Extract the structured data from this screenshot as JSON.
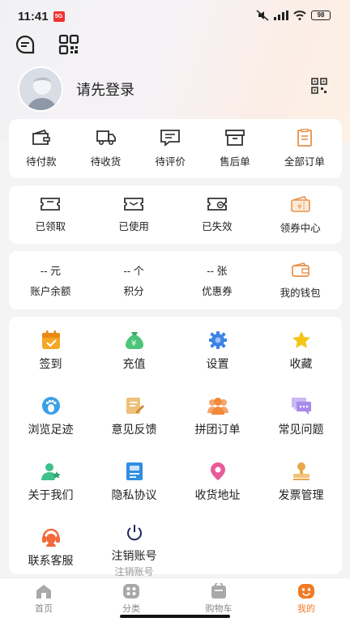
{
  "status": {
    "time": "11:41",
    "notification_badge": "5G",
    "battery": "98"
  },
  "user": {
    "login_prompt": "请先登录"
  },
  "orders": [
    {
      "label": "待付款",
      "icon": "wallet-icon"
    },
    {
      "label": "待收货",
      "icon": "truck-icon"
    },
    {
      "label": "待评价",
      "icon": "comment-icon"
    },
    {
      "label": "售后单",
      "icon": "box-icon"
    },
    {
      "label": "全部订单",
      "icon": "clipboard-icon"
    }
  ],
  "coupons": [
    {
      "label": "已领取",
      "icon": "ticket-received-icon"
    },
    {
      "label": "已使用",
      "icon": "ticket-used-icon"
    },
    {
      "label": "已失效",
      "icon": "ticket-expired-icon"
    },
    {
      "label": "领券中心",
      "icon": "coupon-center-icon"
    }
  ],
  "assets": [
    {
      "value": "-- 元",
      "label": "账户余额"
    },
    {
      "value": "-- 个",
      "label": "积分"
    },
    {
      "value": "-- 张",
      "label": "优惠券"
    },
    {
      "label": "我的钱包",
      "icon": "wallet-icon"
    }
  ],
  "services": [
    {
      "label": "签到",
      "icon": "calendar-check-icon",
      "color": "#f5a623"
    },
    {
      "label": "充值",
      "icon": "money-bag-icon",
      "color": "#4cc47a"
    },
    {
      "label": "设置",
      "icon": "gear-icon",
      "color": "#3b82e6"
    },
    {
      "label": "收藏",
      "icon": "star-icon",
      "color": "#f5c518"
    },
    {
      "label": "浏览足迹",
      "icon": "footprint-icon",
      "color": "#3aa0e8"
    },
    {
      "label": "意见反馈",
      "icon": "feedback-icon",
      "color": "#e6b45a"
    },
    {
      "label": "拼团订单",
      "icon": "group-icon",
      "color": "#f08a3a"
    },
    {
      "label": "常见问题",
      "icon": "chat-bubbles-icon",
      "color": "#a78bea"
    },
    {
      "label": "关于我们",
      "icon": "about-user-icon",
      "color": "#3ec18a"
    },
    {
      "label": "隐私协议",
      "icon": "document-icon",
      "color": "#2f8fe0"
    },
    {
      "label": "收货地址",
      "icon": "location-pin-icon",
      "color": "#e85a9a"
    },
    {
      "label": "发票管理",
      "icon": "stamp-icon",
      "color": "#e8a84a"
    },
    {
      "label": "联系客服",
      "icon": "customer-service-icon",
      "color": "#f26a3a"
    },
    {
      "label": "注销账号",
      "sublabel": "注销账号",
      "icon": "power-icon",
      "color": "#1f2a55"
    }
  ],
  "tabs": [
    {
      "label": "首页",
      "icon": "home-icon"
    },
    {
      "label": "分类",
      "icon": "category-icon"
    },
    {
      "label": "购物车",
      "icon": "cart-icon"
    },
    {
      "label": "我的",
      "icon": "mine-icon",
      "active": true
    }
  ]
}
